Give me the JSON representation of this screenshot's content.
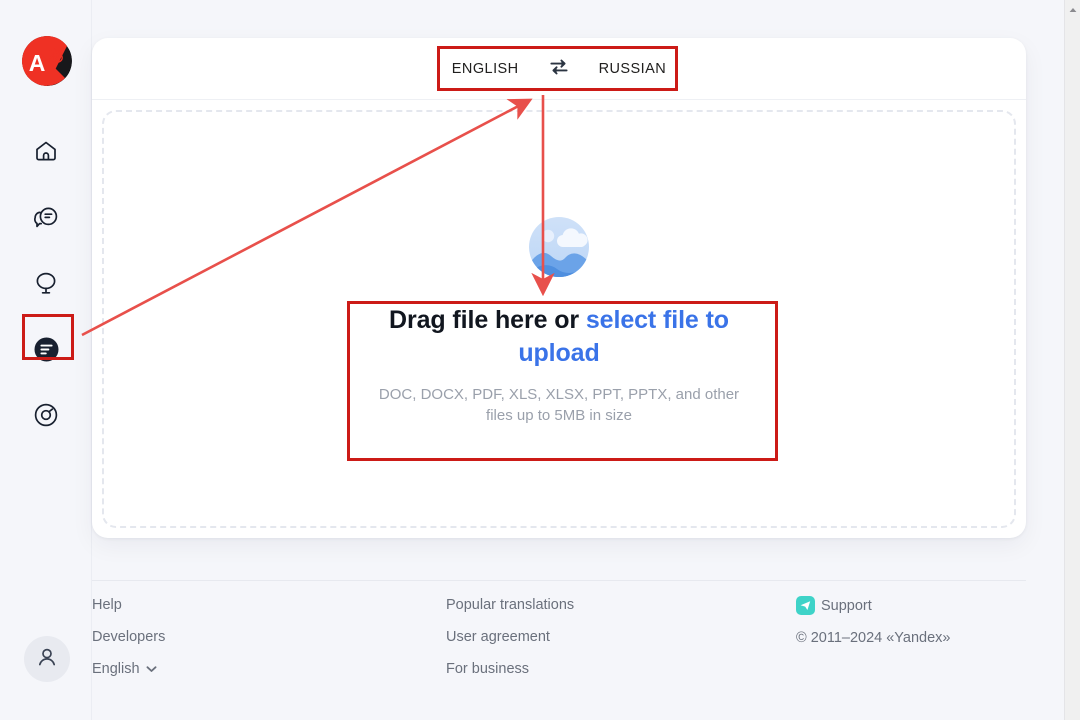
{
  "app": {
    "logo_name": "yandex-translate-logo",
    "logo_left_char": "A",
    "logo_right_char": "あ"
  },
  "sidebar": {
    "items": [
      {
        "icon": "home-icon",
        "name": "sidebar-item-home",
        "selected": false
      },
      {
        "icon": "chat-icon",
        "name": "sidebar-item-chat",
        "selected": false
      },
      {
        "icon": "balloon-icon",
        "name": "sidebar-item-voice",
        "selected": false
      },
      {
        "icon": "document-icon",
        "name": "sidebar-item-document",
        "selected": true
      },
      {
        "icon": "camera-icon",
        "name": "sidebar-item-image",
        "selected": false
      }
    ],
    "avatar_icon": "user-avatar-icon"
  },
  "card": {
    "language_switch": {
      "source_label": "ENGLISH",
      "swap_icon": "swap-arrows-icon",
      "target_label": "RUSSIAN"
    },
    "dropzone": {
      "illustration_icon": "image-placeholder-icon",
      "title_lead": "Drag file here or ",
      "title_link": "select file to upload",
      "subtitle": "DOC, DOCX, PDF, XLS, XLSX, PPT, PPTX, and other files up to 5MB in size"
    }
  },
  "footer": {
    "column1": [
      {
        "label": "Help",
        "name": "footer-link-help"
      },
      {
        "label": "Developers",
        "name": "footer-link-developers"
      }
    ],
    "language_selector": {
      "label": "English",
      "chevron_icon": "chevron-down-icon"
    },
    "column2": [
      {
        "label": "Popular translations",
        "name": "footer-link-popular-translations"
      },
      {
        "label": "User agreement",
        "name": "footer-link-user-agreement"
      },
      {
        "label": "For business",
        "name": "footer-link-for-business"
      }
    ],
    "support": {
      "icon": "support-telegram-icon",
      "label": "Support"
    },
    "copyright": "© 2011–2024 «Yandex»"
  },
  "scrollbar": {
    "up_arrow_icon": "scroll-up-arrow-icon"
  },
  "annotations": {
    "box_language_switch": "highlight-language-switch",
    "box_dropzone_text": "highlight-dropzone-text",
    "box_sidebar_document": "highlight-sidebar-document",
    "arrow_diagonal": "annotation-arrow-sidebar-to-language",
    "arrow_vertical": "annotation-arrow-language-to-dropzone"
  },
  "colors": {
    "accent_link": "#3a73e8",
    "annotation_red": "#cc1b17",
    "logo_red": "#ef3124",
    "support_teal": "#3ed3c8",
    "page_bg": "#f5f6fa"
  }
}
